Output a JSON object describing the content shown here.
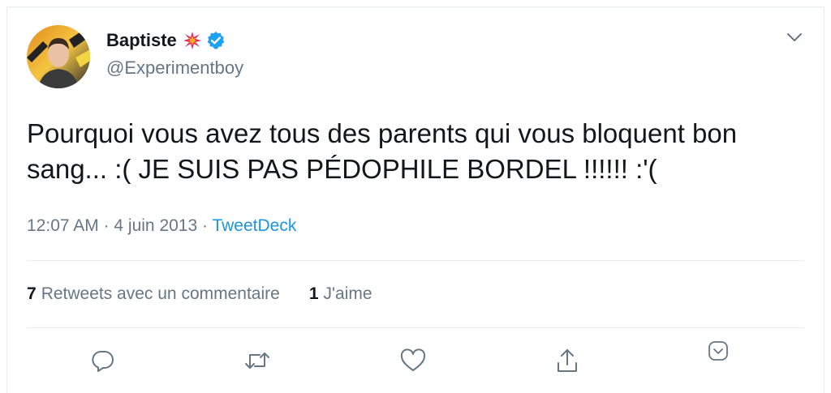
{
  "author": {
    "display_name": "Baptiste",
    "handle": "@Experimentboy",
    "badge_emoji_icon": "collision-icon",
    "verified_icon": "verified-badge-icon"
  },
  "tweet": {
    "text": "Pourquoi vous avez tous des parents qui vous bloquent bon sang... :( JE SUIS PAS PÉDOPHILE BORDEL !!!!!! :'(",
    "time": "12:07 AM",
    "separator1": " · ",
    "date": "4 juin 2013",
    "separator2": " · ",
    "source": "TweetDeck"
  },
  "stats": {
    "retweets_count": "7",
    "retweets_label": "Retweets avec un commentaire",
    "likes_count": "1",
    "likes_label": "J'aime"
  },
  "actions": {
    "reply_icon": "reply-icon",
    "retweet_icon": "retweet-icon",
    "like_icon": "heart-icon",
    "share_icon": "share-icon",
    "more_icon": "chevron-down-icon"
  },
  "colors": {
    "text": "#14171a",
    "secondary": "#657786",
    "link": "#1b95e0",
    "verified": "#1da1f2",
    "icon": "#657786"
  }
}
